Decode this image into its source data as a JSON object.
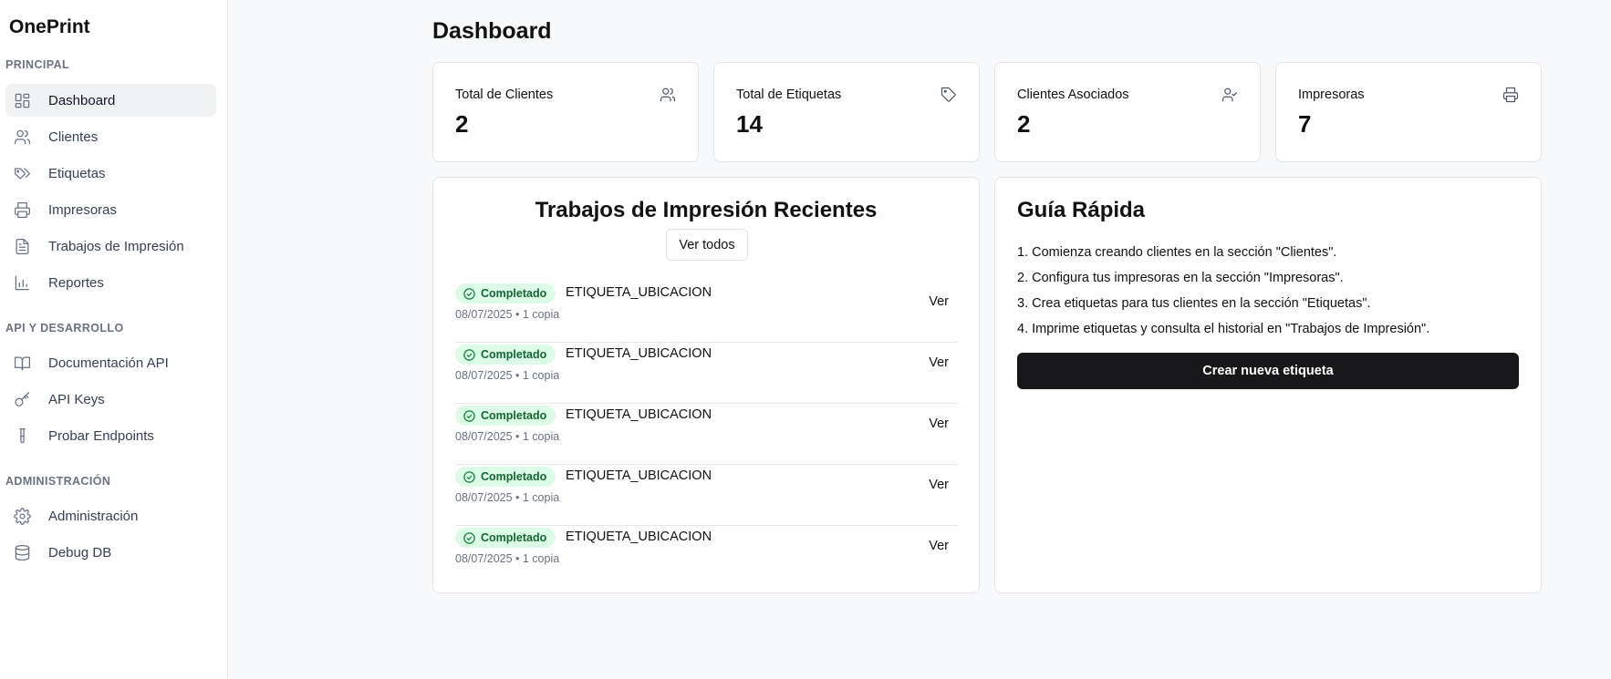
{
  "app": {
    "brand": "OnePrint"
  },
  "sidebar": {
    "sections": [
      {
        "label": "PRINCIPAL"
      },
      {
        "label": "API Y DESARROLLO"
      },
      {
        "label": "ADMINISTRACIÓN"
      }
    ],
    "items": [
      {
        "label": "Dashboard",
        "icon": "dashboard-icon",
        "active": true
      },
      {
        "label": "Clientes",
        "icon": "users-icon"
      },
      {
        "label": "Etiquetas",
        "icon": "tags-icon"
      },
      {
        "label": "Impresoras",
        "icon": "printer-icon"
      },
      {
        "label": "Trabajos de Impresión",
        "icon": "file-text-icon"
      },
      {
        "label": "Reportes",
        "icon": "bar-chart-icon"
      },
      {
        "label": "Documentación API",
        "icon": "book-open-icon"
      },
      {
        "label": "API Keys",
        "icon": "key-icon"
      },
      {
        "label": "Probar Endpoints",
        "icon": "test-tube-icon"
      },
      {
        "label": "Administración",
        "icon": "gear-icon"
      },
      {
        "label": "Debug DB",
        "icon": "database-icon"
      }
    ]
  },
  "main": {
    "title": "Dashboard",
    "stats": [
      {
        "label": "Total de Clientes",
        "value": "2",
        "icon": "users-icon"
      },
      {
        "label": "Total de Etiquetas",
        "value": "14",
        "icon": "tag-icon"
      },
      {
        "label": "Clientes Asociados",
        "value": "2",
        "icon": "user-check-icon"
      },
      {
        "label": "Impresoras",
        "value": "7",
        "icon": "printer-icon"
      }
    ],
    "jobs": {
      "title": "Trabajos de Impresión Recientes",
      "view_all": "Ver todos",
      "items": [
        {
          "status": "Completado",
          "name": "ETIQUETA_UBICACION",
          "meta": "08/07/2025 • 1 copia",
          "action": "Ver"
        },
        {
          "status": "Completado",
          "name": "ETIQUETA_UBICACION",
          "meta": "08/07/2025 • 1 copia",
          "action": "Ver"
        },
        {
          "status": "Completado",
          "name": "ETIQUETA_UBICACION",
          "meta": "08/07/2025 • 1 copia",
          "action": "Ver"
        },
        {
          "status": "Completado",
          "name": "ETIQUETA_UBICACION",
          "meta": "08/07/2025 • 1 copia",
          "action": "Ver"
        },
        {
          "status": "Completado",
          "name": "ETIQUETA_UBICACION",
          "meta": "08/07/2025 • 1 copia",
          "action": "Ver"
        }
      ]
    },
    "guide": {
      "title": "Guía Rápida",
      "steps": [
        "1. Comienza creando clientes en la sección \"Clientes\".",
        "2. Configura tus impresoras en la sección \"Impresoras\".",
        "3. Crea etiquetas para tus clientes en la sección \"Etiquetas\".",
        "4. Imprime etiquetas y consulta el historial en \"Trabajos de Impresión\"."
      ],
      "cta": "Crear nueva etiqueta"
    }
  },
  "colors": {
    "accent_dark": "#18181b",
    "success_bg": "#dcfce7",
    "success_text": "#166534",
    "page_bg": "#f8f9fa"
  }
}
